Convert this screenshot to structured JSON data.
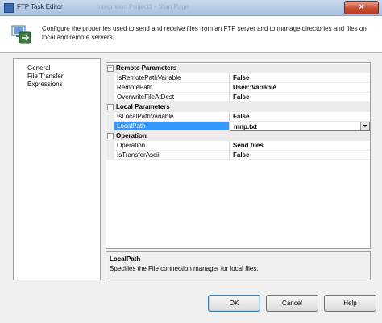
{
  "window": {
    "title": "FTP Task Editor",
    "ghost_title": "Integration Project1 - Start Page",
    "close_glyph": "×"
  },
  "header": {
    "description": "Configure the properties used to send and receive files from an FTP server and to manage directories and files on local and remote servers."
  },
  "nav": {
    "items": [
      {
        "label": "General"
      },
      {
        "label": "File Transfer"
      },
      {
        "label": "Expressions"
      }
    ]
  },
  "grid": {
    "categories": [
      {
        "label": "Remote Parameters",
        "expander": "−",
        "properties": [
          {
            "name": "IsRemotePathVariable",
            "value": "False"
          },
          {
            "name": "RemotePath",
            "value": "User::Variable"
          },
          {
            "name": "OverwriteFileAtDest",
            "value": "False"
          }
        ]
      },
      {
        "label": "Local Parameters",
        "expander": "−",
        "properties": [
          {
            "name": "IsLocalPathVariable",
            "value": "False"
          },
          {
            "name": "LocalPath",
            "value": "mnp.txt"
          }
        ]
      },
      {
        "label": "Operation",
        "expander": "−",
        "properties": [
          {
            "name": "Operation",
            "value": "Send files"
          },
          {
            "name": "IsTransferAscii",
            "value": "False"
          }
        ]
      }
    ]
  },
  "description_panel": {
    "title": "LocalPath",
    "text": "Specifies the File connection manager for local files."
  },
  "buttons": {
    "ok": "OK",
    "cancel": "Cancel",
    "help": "Help"
  },
  "colors": {
    "selection": "#3399ff",
    "category_bg": "#ececec"
  }
}
